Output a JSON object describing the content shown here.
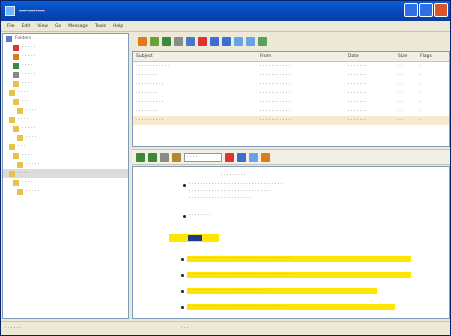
{
  "colors": {
    "titlebar": "#0a5fd8",
    "accent_yellow": "#ffe600",
    "accent_red": "#d11111",
    "selection": "#f6e9cc"
  },
  "window": {
    "title": "—·—·—"
  },
  "menu": {
    "items": [
      "File",
      "Edit",
      "View",
      "Go",
      "Message",
      "Tools",
      "Help"
    ]
  },
  "folder_tree": {
    "items": [
      {
        "label": "Folders",
        "count": "",
        "icon": "computer-icon"
      },
      {
        "label": "· · · · ·",
        "count": "",
        "icon": "inbox-icon"
      },
      {
        "label": "· · · · ·",
        "count": "",
        "icon": "outbox-icon"
      },
      {
        "label": "· · · ·",
        "count": "",
        "icon": "sent-icon"
      },
      {
        "label": "· · · · ·",
        "count": "",
        "icon": "deleted-icon"
      },
      {
        "label": "· · · ·",
        "count": "",
        "icon": "folder-icon"
      },
      {
        "label": "· · · ·",
        "count": "",
        "icon": "folder-icon"
      },
      {
        "label": "· · ·",
        "count": "",
        "icon": "folder-icon"
      },
      {
        "label": "· · · ·",
        "count": "",
        "icon": "folder-icon"
      },
      {
        "label": "· · · ·",
        "count": "",
        "icon": "folder-icon"
      },
      {
        "label": "· · · · ·",
        "count": "",
        "icon": "folder-icon"
      },
      {
        "label": "· · · ·",
        "count": "",
        "icon": "folder-icon"
      },
      {
        "label": "· · ·",
        "count": "",
        "icon": "folder-icon"
      },
      {
        "label": "· · · ·",
        "count": "",
        "icon": "folder-icon"
      },
      {
        "label": "· · · · ·",
        "count": "",
        "icon": "folder-icon"
      },
      {
        "label": "· · · ·",
        "count": "",
        "icon": "folder-icon"
      },
      {
        "label": "· · · ·",
        "count": "",
        "icon": "folder-icon"
      },
      {
        "label": "· · · · ·",
        "count": "",
        "icon": "folder-icon"
      }
    ]
  },
  "message_list": {
    "columns": [
      "Subject",
      "From",
      "Date",
      "Size",
      "Flags"
    ],
    "rows": [
      {
        "subject": "· · · · · · · · · · · ·",
        "from": "· · · · · · · · · · ·",
        "date": "· · · · · · ·",
        "size": "· ·",
        "flags": "·",
        "unread": true
      },
      {
        "subject": "· · · · · · · ·",
        "from": "· · · · · · · · · · ·",
        "date": "· · · · · · ·",
        "size": "· ·",
        "flags": "·",
        "unread": false
      },
      {
        "subject": "· · · · · · · · · ·",
        "from": "· · · · · · · · · · ·",
        "date": "· · · · · · ·",
        "size": "· ·",
        "flags": "·",
        "unread": false
      },
      {
        "subject": "· · · · · · · ·",
        "from": "· · · · · · · · · · ·",
        "date": "· · · · · · ·",
        "size": "· ·",
        "flags": "·",
        "unread": false
      },
      {
        "subject": "· · · · · · · · · ·",
        "from": "· · · · · · · · · · ·",
        "date": "· · · · · · ·",
        "size": "· ·",
        "flags": "·",
        "unread": false
      },
      {
        "subject": "· · · · · · · ·",
        "from": "· · · · · · · · · · ·",
        "date": "· · · · · · ·",
        "size": "· ·",
        "flags": "·",
        "unread": false
      },
      {
        "subject": "· · · · · · · · · ·",
        "from": "· · · · · · · · · · ·",
        "date": "· · · · · · ·",
        "size": "· ·",
        "flags": "·",
        "unread": false
      }
    ]
  },
  "preview_toolbar": {
    "font_name": "· · · ·"
  },
  "preview": {
    "lines": [
      "· · · · · · · · ·",
      "· · · · · · · · · · · · · · · · · · · · · · · · · · · · · · · · ·",
      "· · · · · · · · · · · · · · · · · · · · · · · · · · · · ·",
      "· · · · · · · · · · · · · · · · · · · · · ·",
      "· · · · · · · ·"
    ],
    "highlighted": [
      "· · · · · · · · · · · · · · · · · · · · · · · · · · · · · · · · · · · ·",
      "· · · · · · · · · · · · · · · · · · · · · · · · · · · · · · · · · · · · ·",
      "· · · · · · · · · · · · · · · · · · · · · · · · · · ·",
      "· · · · · · · · · · · · · · · · · · · · · · · · · · · · · · · · · ·"
    ]
  },
  "status": {
    "left": "· · · · · ·",
    "right": "· · ·"
  }
}
